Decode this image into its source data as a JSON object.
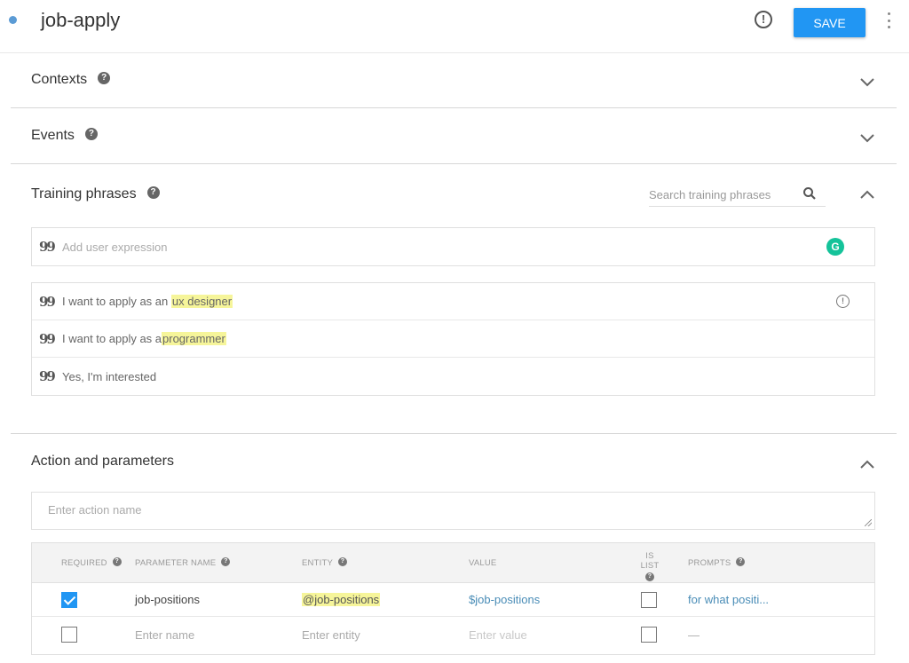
{
  "header": {
    "title": "job-apply",
    "save_label": "SAVE",
    "status_dot_color": "#5b9bd5",
    "accent_color": "#2196f3"
  },
  "sections": {
    "contexts": {
      "title": "Contexts",
      "help": "?"
    },
    "events": {
      "title": "Events",
      "help": "?"
    },
    "training": {
      "title": "Training phrases",
      "help": "?",
      "search_placeholder": "Search training phrases",
      "add_placeholder": "Add user expression",
      "grammarly_label": "G",
      "phrases": [
        {
          "text": "I want to apply as an ",
          "highlight": "ux designer",
          "has_warning": true
        },
        {
          "text": "I want to apply as a ",
          "highlight": "programmer",
          "has_warning": false
        },
        {
          "text": "Yes, I'm interested",
          "highlight": "",
          "has_warning": false
        }
      ]
    },
    "action": {
      "title": "Action and parameters",
      "action_placeholder": "Enter action name",
      "columns": {
        "required": "REQUIRED",
        "parameter_name": "PARAMETER NAME",
        "entity": "ENTITY",
        "value": "VALUE",
        "is_list": "IS LIST",
        "prompts": "PROMPTS"
      },
      "rows": [
        {
          "required": true,
          "name": "job-positions",
          "entity": "@job-positions",
          "value": "$job-positions",
          "is_list": false,
          "prompts": "for what positi..."
        },
        {
          "required": false,
          "name_placeholder": "Enter name",
          "entity_placeholder": "Enter entity",
          "value_placeholder": "Enter value",
          "is_list": false,
          "prompts": "—"
        }
      ]
    }
  }
}
